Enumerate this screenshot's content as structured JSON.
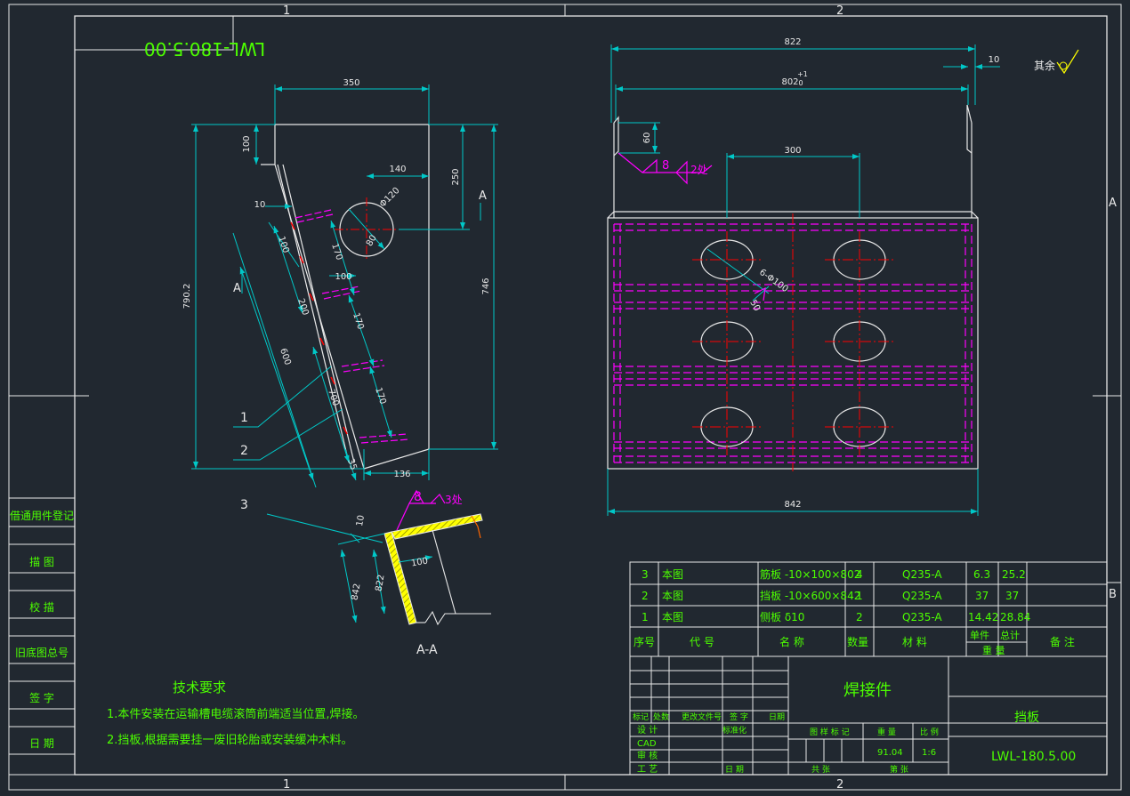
{
  "colors": {
    "background": "#212830",
    "frame": "#e8e8e8",
    "dimension": "#00c8c8",
    "annotation": "#4cff00",
    "hidden_line": "#ff00ff",
    "center_line": "#ff0000",
    "weld_symbol": "#ff00ff",
    "cut_edge": "#ff6600",
    "weld_fill": "#ffff00"
  },
  "zones": {
    "top_1": "1",
    "top_2": "2",
    "bottom_1": "1",
    "bottom_2": "2",
    "right_a": "A",
    "right_b": "B"
  },
  "drawing_number_mirrored": "LWL-180.5.00",
  "side_view": {
    "dims": {
      "top_width": "350",
      "top_drop": "100",
      "hole_offset": "140",
      "hole_height": "250",
      "hole_dia": "Φ120",
      "hole_inner": "80",
      "overall_height": "790.2",
      "right_height": "746",
      "bottom_width": "136",
      "edge_10": "10",
      "rib_100": "100",
      "rib_170a": "170",
      "slot_100": "100",
      "rib_170b": "170",
      "rib_170c": "170",
      "span_200": "200",
      "span_600": "600",
      "span_700": "700",
      "bottom_35": "35"
    },
    "section_mark": "A",
    "balloons": [
      "1",
      "2",
      "3"
    ]
  },
  "front_view": {
    "dims": {
      "top_822": "822",
      "inner_802": "802",
      "tol_plus": "+1",
      "tol_zero": "0",
      "right_10": "10",
      "height_60": "60",
      "spacing_300": "300",
      "holes": "6-Φ100",
      "chamfer": "50",
      "bottom_842": "842"
    },
    "weld_size": "8",
    "weld_count": "2处",
    "roughness_note": "其余"
  },
  "section_view": {
    "label": "A-A",
    "dims": {
      "d10": "10",
      "d822": "822",
      "d842": "842",
      "d100": "100"
    },
    "weld_size": "8",
    "weld_count": "3处"
  },
  "tech_requirements": {
    "title": "技术要求",
    "items": [
      "1.本件安装在运输槽电缆滚筒前端适当位置,焊接。",
      "2.挡板,根据需要挂一废旧轮胎或安装缓冲木料。"
    ]
  },
  "left_stamp": {
    "rows": [
      "借通用件登记",
      "描 图",
      "校 描",
      "旧底图总号",
      "签 字",
      "日 期"
    ]
  },
  "bom": {
    "rows": [
      {
        "seq": "3",
        "code": "本图",
        "name": "筋板 -10×100×802",
        "qty": "4",
        "material": "Q235-A",
        "unit_wt": "6.3",
        "total_wt": "25.2",
        "note": ""
      },
      {
        "seq": "2",
        "code": "本图",
        "name": "挡板 -10×600×842",
        "qty": "1",
        "material": "Q235-A",
        "unit_wt": "37",
        "total_wt": "37",
        "note": ""
      },
      {
        "seq": "1",
        "code": "本图",
        "name": "侧板 δ10",
        "qty": "2",
        "material": "Q235-A",
        "unit_wt": "14.42",
        "total_wt": "28.84",
        "note": ""
      }
    ],
    "headers": {
      "seq": "序号",
      "code": "代 号",
      "name": "名 称",
      "qty": "数量",
      "material": "材 料",
      "unit": "单件",
      "total": "总计",
      "weight": "重 量",
      "note": "备 注"
    }
  },
  "title_block": {
    "assembly_type": "焊接件",
    "part_name": "挡板",
    "drawing_no": "LWL-180.5.00",
    "rev_headers": [
      "标记",
      "处数",
      "更改文件号",
      "签 字",
      "日期"
    ],
    "sign_labels": [
      "设 计",
      "CAD",
      "审 核",
      "工 艺"
    ],
    "std_label": "标准化",
    "date_label": "日 期",
    "stage_label": "图 样 标 记",
    "weight_label": "重 量",
    "scale_label": "比 例",
    "weight_value": "91.04",
    "scale_value": "1:6",
    "total_label": "共 张",
    "sheet_label": "第 张"
  }
}
